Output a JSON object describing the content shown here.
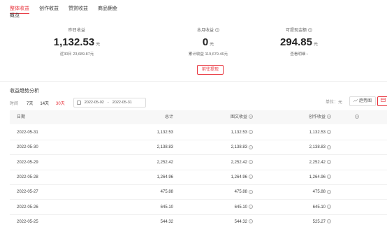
{
  "tabs": [
    "整体收益",
    "创作收益",
    "赞赏收益",
    "商品佣金"
  ],
  "subtab": "概览",
  "stats": {
    "yesterday": {
      "label": "昨日收益",
      "value": "1,132.53",
      "unit": "元",
      "sub": "近30日 23,689.87元"
    },
    "month": {
      "label": "本月收益",
      "value": "0",
      "unit": "元",
      "sub": "累计收益 119,679.46元"
    },
    "withdrawable": {
      "label": "可提现金额",
      "value": "294.85",
      "unit": "元",
      "sub": "查看明细 ›"
    }
  },
  "withdraw_button": "前往提现",
  "analysis": {
    "title": "收益趋势分析",
    "time_label": "时间",
    "periods": [
      "7天",
      "14天",
      "30天"
    ],
    "active_period": "30天",
    "date_start": "2022-05-02",
    "date_separator": "-",
    "date_end": "2022-05-31",
    "unit_label": "单位：元",
    "trend_button": "趋势图"
  },
  "table": {
    "headers": {
      "date": "日期",
      "total": "总计",
      "content": "图文收益",
      "creative": "创作收益"
    },
    "rows": [
      {
        "date": "2022-05-31",
        "total": "1,132.53",
        "content": "1,132.53",
        "creative": "1,132.53"
      },
      {
        "date": "2022-05-30",
        "total": "2,138.83",
        "content": "2,138.83",
        "creative": "2,138.83"
      },
      {
        "date": "2022-05-29",
        "total": "2,252.42",
        "content": "2,252.42",
        "creative": "2,252.42"
      },
      {
        "date": "2022-05-28",
        "total": "1,264.96",
        "content": "1,264.96",
        "creative": "1,264.96"
      },
      {
        "date": "2022-05-27",
        "total": "475.88",
        "content": "475.88",
        "creative": "475.88"
      },
      {
        "date": "2022-05-26",
        "total": "645.10",
        "content": "645.10",
        "creative": "645.10"
      },
      {
        "date": "2022-05-25",
        "total": "544.32",
        "content": "544.32",
        "creative": "525.27"
      }
    ]
  },
  "colors": {
    "accent": "#e8333c"
  }
}
